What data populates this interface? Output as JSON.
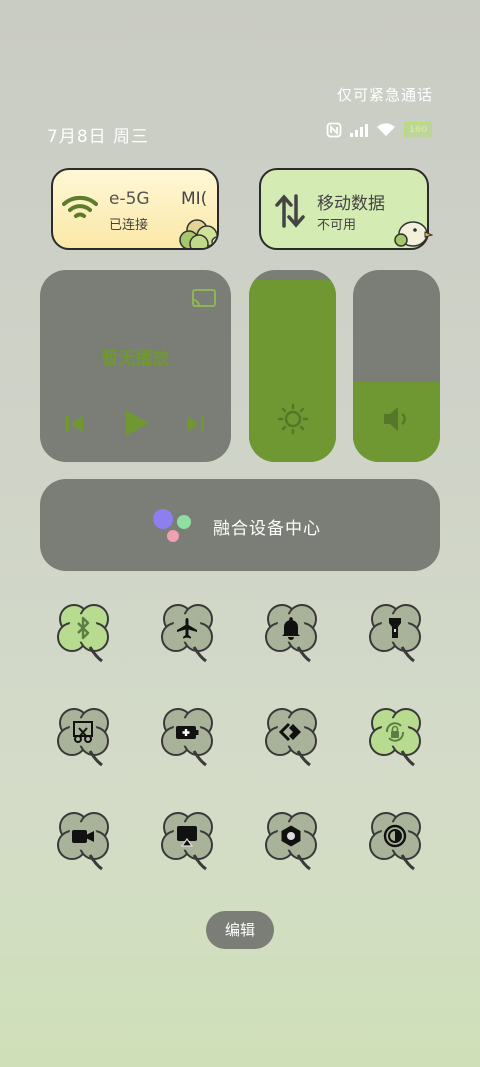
{
  "status_bar": {
    "emergency_text": "仅可紧急通话",
    "datetime": "7月8日 周三",
    "battery_level": "160",
    "icons": [
      "nfc-icon",
      "signal-icon",
      "wifi-icon",
      "battery-icon"
    ]
  },
  "wifi_tile": {
    "title": "e-5G",
    "title_tail": "MI(",
    "subtitle": "已连接",
    "icon": "wifi-icon"
  },
  "data_tile": {
    "title": "移动数据",
    "subtitle": "不可用",
    "icon": "data-arrows-icon"
  },
  "media": {
    "text": "暂无播放",
    "icons": [
      "cast-icon",
      "previous-icon",
      "play-icon",
      "next-icon"
    ]
  },
  "sliders": {
    "brightness_level": 0.95,
    "volume_level": 0.42,
    "accent": "#6f9832"
  },
  "hub": {
    "label": "融合设备中心"
  },
  "toggles": [
    {
      "name": "bluetooth",
      "icon": "bluetooth-icon",
      "active": true
    },
    {
      "name": "airplane",
      "icon": "airplane-icon",
      "active": false
    },
    {
      "name": "ringer",
      "icon": "bell-icon",
      "active": false
    },
    {
      "name": "flashlight",
      "icon": "flashlight-icon",
      "active": false
    },
    {
      "name": "screenshot",
      "icon": "scissors-icon",
      "active": false
    },
    {
      "name": "battery-saver",
      "icon": "battery-plus-icon",
      "active": false
    },
    {
      "name": "hotspot",
      "icon": "link-icon",
      "active": false
    },
    {
      "name": "rotation-lock",
      "icon": "rotation-lock-icon",
      "active": true
    },
    {
      "name": "screen-record",
      "icon": "video-icon",
      "active": false
    },
    {
      "name": "screen-cast",
      "icon": "airplay-icon",
      "active": false
    },
    {
      "name": "nut",
      "icon": "hexagon-icon",
      "active": false
    },
    {
      "name": "dark-mode",
      "icon": "dark-mode-icon",
      "active": false
    }
  ],
  "colors": {
    "clover_active": "#b8dc8f",
    "clover_inactive": "#a8b39a",
    "panel": "#7b7d77"
  },
  "edit_button": {
    "label": "编辑"
  }
}
